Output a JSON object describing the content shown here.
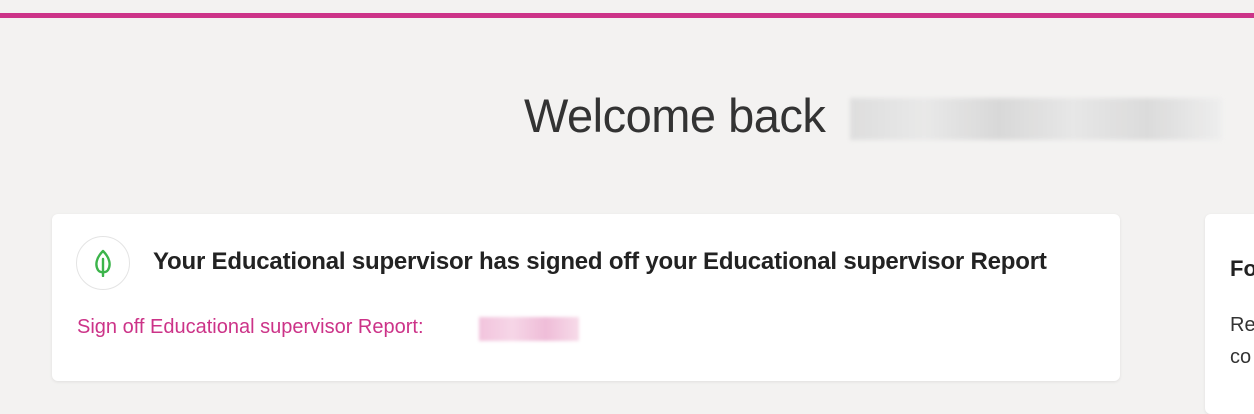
{
  "header": {
    "accent_color": "#cc3388"
  },
  "welcome": {
    "text": "Welcome back"
  },
  "notification": {
    "icon": "leaf-icon",
    "title": "Your Educational supervisor has signed off your Educational supervisor Report",
    "link_text": "Sign off Educational supervisor Report:"
  },
  "side_card": {
    "title_fragment": "Fo",
    "line1_fragment": "Re",
    "line2_fragment": "co"
  }
}
